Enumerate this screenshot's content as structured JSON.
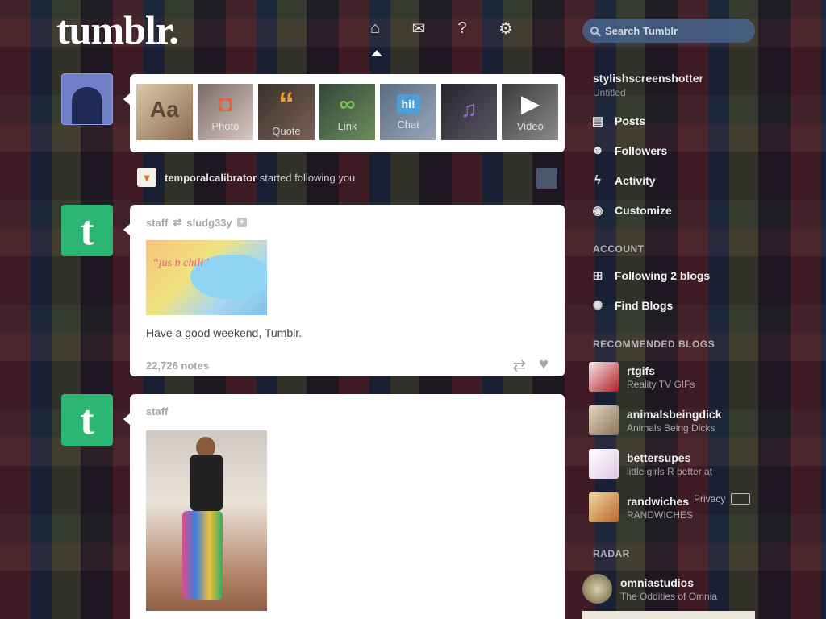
{
  "header": {
    "logo": "tumblr.",
    "search_placeholder": "Search Tumblr",
    "nav_icons": [
      "home-icon",
      "inbox-icon",
      "help-icon",
      "settings-icon"
    ]
  },
  "composer": {
    "types": [
      {
        "icon": "Aa",
        "label": ""
      },
      {
        "icon": "◘",
        "label": "Photo"
      },
      {
        "icon": "“",
        "label": "Quote"
      },
      {
        "icon": "∞",
        "label": "Link"
      },
      {
        "icon": "hi!",
        "label": "Chat"
      },
      {
        "icon": "♫",
        "label": ""
      },
      {
        "icon": "▶",
        "label": "Video"
      }
    ]
  },
  "notification": {
    "user": "temporalcalibrator",
    "text": "started following you"
  },
  "posts": [
    {
      "author": "staff",
      "reblogged_from": "sludg33y",
      "image_caption": "“jus b chill”",
      "body": "Have a good weekend, Tumblr.",
      "notes": "22,726 notes"
    },
    {
      "author": "staff"
    }
  ],
  "sidebar": {
    "blog_name": "stylishscreenshotter",
    "blog_sub": "Untitled",
    "links": [
      {
        "icon": "posts-icon",
        "label": "Posts"
      },
      {
        "icon": "followers-icon",
        "label": "Followers"
      },
      {
        "icon": "activity-icon",
        "label": "Activity"
      },
      {
        "icon": "customize-icon",
        "label": "Customize"
      }
    ],
    "account_heading": "ACCOUNT",
    "account_links": [
      {
        "icon": "following-icon",
        "label": "Following 2 blogs"
      },
      {
        "icon": "find-blogs-icon",
        "label": "Find Blogs"
      }
    ],
    "recommended_heading": "RECOMMENDED BLOGS",
    "recommended": [
      {
        "name": "rtgifs",
        "sub": "Reality TV GIFs"
      },
      {
        "name": "animalsbeingdick",
        "sub": "Animals Being Dicks"
      },
      {
        "name": "bettersupes",
        "sub": "little girls R better at"
      },
      {
        "name": "randwiches",
        "sub": "RANDWICHES"
      }
    ],
    "privacy": "Privacy",
    "radar_heading": "RADAR",
    "radar": {
      "name": "omniastudios",
      "sub": "The Oddities of Omnia"
    }
  }
}
